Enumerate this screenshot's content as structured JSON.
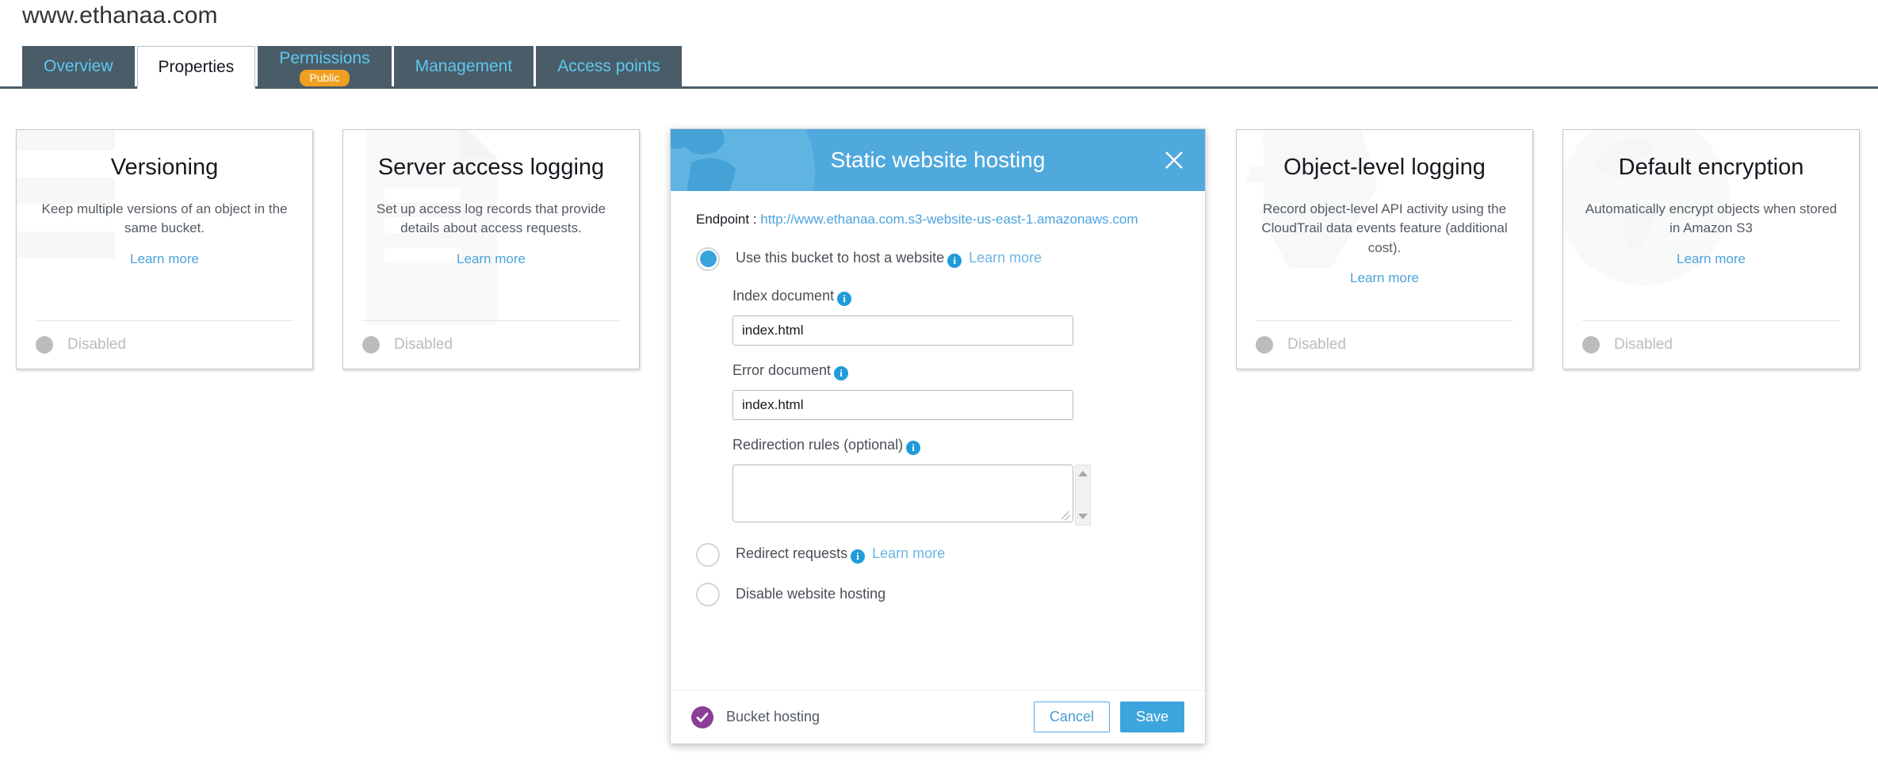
{
  "header": {
    "bucket_name": "www.ethanaa.com"
  },
  "tabs": [
    {
      "label": "Overview",
      "active": false,
      "badge": null
    },
    {
      "label": "Properties",
      "active": true,
      "badge": null
    },
    {
      "label": "Permissions",
      "active": false,
      "badge": "Public"
    },
    {
      "label": "Management",
      "active": false,
      "badge": null
    },
    {
      "label": "Access points",
      "active": false,
      "badge": null
    }
  ],
  "cards": [
    {
      "title": "Versioning",
      "description": "Keep multiple versions of an object in the same bucket.",
      "link": "Learn more",
      "status": "Disabled",
      "watermark": "stacked-layers-icon"
    },
    {
      "title": "Server access logging",
      "description": "Set up access log records that provide details about access requests.",
      "link": "Learn more",
      "status": "Disabled",
      "watermark": "document-icon"
    },
    {
      "title": "Object-level logging",
      "description": "Record object-level API activity using the CloudTrail data events feature (additional cost).",
      "link": "Learn more",
      "status": "Disabled",
      "watermark": "shield-icon"
    },
    {
      "title": "Default encryption",
      "description": "Automatically encrypt objects when stored in Amazon S3",
      "link": "Learn more",
      "status": "Disabled",
      "watermark": "globe-icon"
    }
  ],
  "modal": {
    "title": "Static website hosting",
    "close_icon": "close-icon",
    "endpoint_label": "Endpoint :",
    "endpoint_url": "http://www.ethanaa.com.s3-website-us-east-1.amazonaws.com",
    "options": [
      {
        "label": "Use this bucket to host a website",
        "selected": true,
        "learn_more": "Learn more",
        "has_info": true
      },
      {
        "label": "Redirect requests",
        "selected": false,
        "learn_more": "Learn more",
        "has_info": true
      },
      {
        "label": "Disable website hosting",
        "selected": false,
        "learn_more": null,
        "has_info": false
      }
    ],
    "fields": {
      "index_label": "Index document",
      "index_value": "index.html",
      "error_label": "Error document",
      "error_value": "index.html",
      "redirection_label": "Redirection rules (optional)",
      "redirection_value": ""
    },
    "footer": {
      "status_label": "Bucket hosting",
      "cancel_label": "Cancel",
      "save_label": "Save"
    }
  },
  "colors": {
    "tab_bar": "#4a5c68",
    "tab_link": "#5dc8f0",
    "badge_public": "#f0a020",
    "modal_header": "#4fa9dd",
    "accent_blue": "#3da5dd",
    "link_blue": "#4ba3dd",
    "purple_badge": "#8b3f94",
    "disabled_grey": "#bcbcbc"
  }
}
